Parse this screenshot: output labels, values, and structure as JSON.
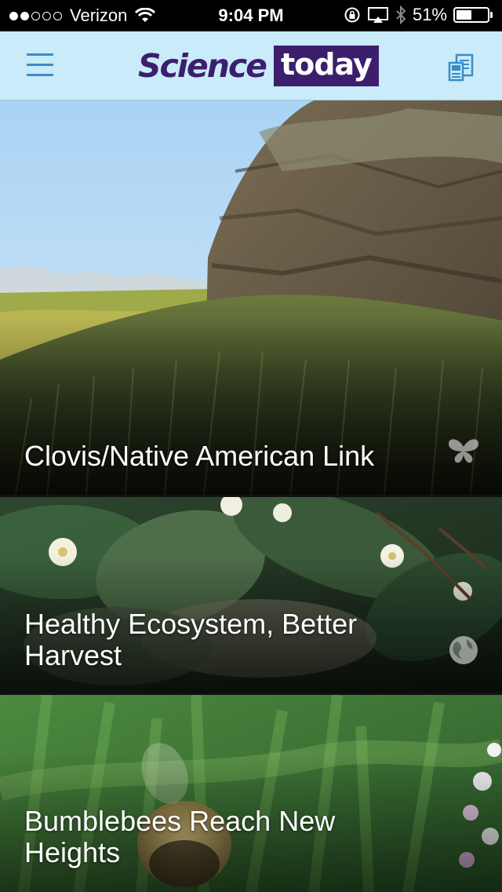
{
  "status_bar": {
    "carrier": "Verizon",
    "signal_dots_filled": 2,
    "signal_dots_total": 5,
    "time": "9:04 PM",
    "battery": "51%",
    "battery_level": 0.51
  },
  "header": {
    "logo_word1": "Science",
    "logo_word2": "today",
    "brand_color": "#3d1e6d",
    "nav_bg": "#c9ebfa",
    "icon_color": "#3a8cc6"
  },
  "feed": {
    "articles": [
      {
        "title": "Clovis/Native American Link",
        "category_icon": "butterfly-icon"
      },
      {
        "title": "Healthy Ecosystem, Better Harvest",
        "category_icon": "globe-icon"
      },
      {
        "title": "Bumblebees Reach New Heights",
        "category_icon": ""
      }
    ]
  }
}
